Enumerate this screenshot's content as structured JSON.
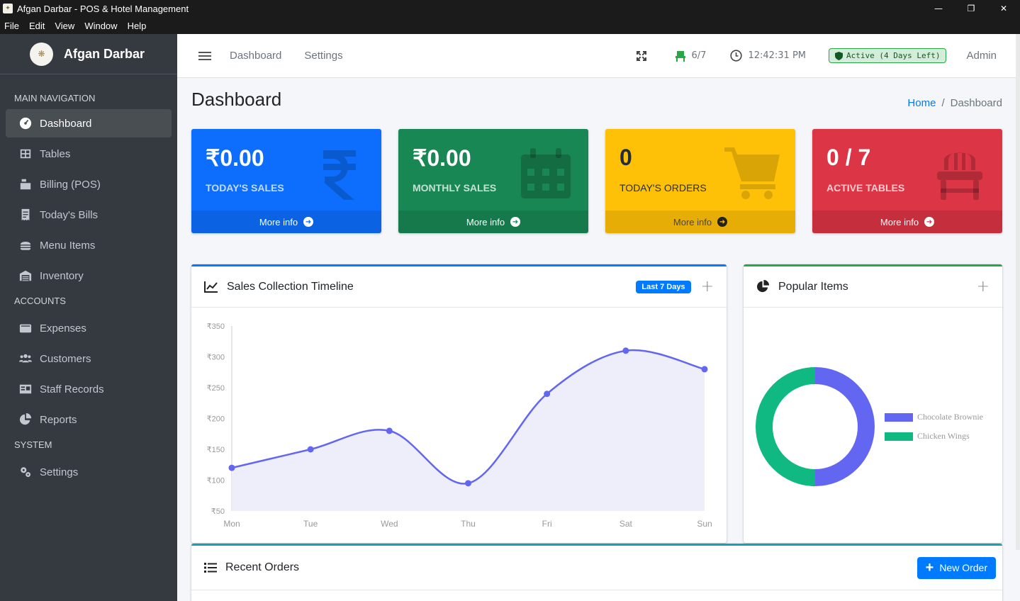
{
  "window": {
    "title": "Afgan Darbar - POS & Hotel Management",
    "menu": [
      "File",
      "Edit",
      "View",
      "Window",
      "Help"
    ]
  },
  "sidebar": {
    "brand": "Afgan Darbar",
    "sections": {
      "main": "MAIN NAVIGATION",
      "accounts": "ACCOUNTS",
      "system": "SYSTEM"
    },
    "items": [
      {
        "label": "Dashboard",
        "icon": "dashboard-icon"
      },
      {
        "label": "Tables",
        "icon": "table-icon"
      },
      {
        "label": "Billing (POS)",
        "icon": "cash-register-icon"
      },
      {
        "label": "Today's Bills",
        "icon": "receipt-icon"
      },
      {
        "label": "Menu Items",
        "icon": "burger-icon"
      },
      {
        "label": "Inventory",
        "icon": "warehouse-icon"
      },
      {
        "label": "Expenses",
        "icon": "wallet-icon"
      },
      {
        "label": "Customers",
        "icon": "users-icon"
      },
      {
        "label": "Staff Records",
        "icon": "id-card-icon"
      },
      {
        "label": "Reports",
        "icon": "pie-chart-icon"
      },
      {
        "label": "Settings",
        "icon": "cogs-icon"
      }
    ]
  },
  "topnav": {
    "links": [
      "Dashboard",
      "Settings"
    ],
    "tables": "6/7",
    "time": "12:42:31 PM",
    "status": "Active (4 Days Left)",
    "user": "Admin"
  },
  "page": {
    "title": "Dashboard",
    "breadcrumb": {
      "home": "Home",
      "current": "Dashboard"
    }
  },
  "stats": [
    {
      "value": "₹0.00",
      "label": "TODAY'S SALES",
      "footer": "More info",
      "color": "#007bff"
    },
    {
      "value": "₹0.00",
      "label": "MONTHLY SALES",
      "footer": "More info",
      "color": "#28a745"
    },
    {
      "value": "0",
      "label": "TODAY'S ORDERS",
      "footer": "More info",
      "color": "#ffc107"
    },
    {
      "value": "0 / 7",
      "label": "ACTIVE TABLES",
      "footer": "More info",
      "color": "#dc3545"
    }
  ],
  "sales_card": {
    "title": "Sales Collection Timeline",
    "badge": "Last 7 Days"
  },
  "popular_card": {
    "title": "Popular Items"
  },
  "orders_card": {
    "title": "Recent Orders",
    "button": "New Order"
  },
  "chart_data": [
    {
      "type": "area",
      "categories": [
        "Mon",
        "Tue",
        "Wed",
        "Thu",
        "Fri",
        "Sat",
        "Sun"
      ],
      "series": [
        {
          "values": [
            120,
            150,
            180,
            95,
            240,
            310,
            280
          ]
        }
      ],
      "ylim": [
        50,
        350
      ],
      "yticks": [
        "₹50",
        "₹100",
        "₹150",
        "₹200",
        "₹250",
        "₹300",
        "₹350"
      ],
      "line_color": "#6366f1",
      "fill_color": "#eeeefb"
    },
    {
      "type": "pie",
      "donut": true,
      "labels": [
        "Chocolate Brownie",
        "Chicken Wings"
      ],
      "values": [
        50,
        50
      ],
      "colors": [
        "#6366f1",
        "#10b981"
      ]
    }
  ]
}
